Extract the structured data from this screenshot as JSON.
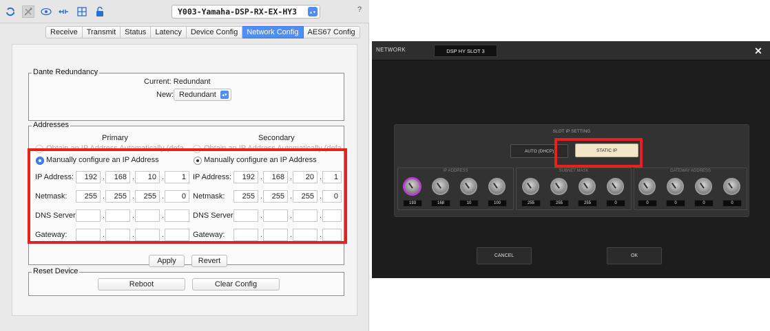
{
  "dante": {
    "device_name": "Y003-Yamaha-DSP-RX-EX-HY3",
    "help_label": "?",
    "tabs": [
      {
        "label": "Receive"
      },
      {
        "label": "Transmit"
      },
      {
        "label": "Status"
      },
      {
        "label": "Latency"
      },
      {
        "label": "Device Config"
      },
      {
        "label": "Network Config",
        "active": true
      },
      {
        "label": "AES67 Config"
      }
    ],
    "redundancy": {
      "title": "Dante Redundancy",
      "current": "Current: Redundant",
      "new_label": "New:",
      "new_value": "Redundant"
    },
    "addresses": {
      "title": "Addresses",
      "primary": {
        "heading": "Primary",
        "auto_option": "Obtain an IP Address Automatically (default)",
        "manual_option": "Manually configure an IP Address",
        "ip_label": "IP Address:",
        "ip": [
          "192",
          "168",
          "10",
          "1"
        ],
        "netmask_label": "Netmask:",
        "netmask": [
          "255",
          "255",
          "255",
          "0"
        ],
        "dns_label": "DNS Server:",
        "gateway_label": "Gateway:"
      },
      "secondary": {
        "heading": "Secondary",
        "auto_option": "Obtain an IP Address Automatically (default)",
        "manual_option": "Manually configure an IP Address",
        "ip_label": "IP Address:",
        "ip": [
          "192",
          "168",
          "20",
          "1"
        ],
        "netmask_label": "Netmask:",
        "netmask": [
          "255",
          "255",
          "255",
          "0"
        ],
        "dns_label": "DNS Server:",
        "gateway_label": "Gateway:"
      }
    },
    "apply_label": "Apply",
    "revert_label": "Revert",
    "reset": {
      "title": "Reset Device",
      "reboot_label": "Reboot",
      "clear_label": "Clear Config"
    },
    "highlight_color": "#e32222",
    "accent_color": "#4e8ef7"
  },
  "yamaha": {
    "title": "NETWORK",
    "slot_tab": "DSP HY SLOT 3",
    "close_label": "✕",
    "slot_setting_title": "SLOT IP SETTING",
    "auto_dhcp_label": "AUTO (DHCP)",
    "static_ip_label": "STATIC IP",
    "ip_address": {
      "title": "IP ADDRESS",
      "values": [
        "193",
        "168",
        "10",
        "100"
      ]
    },
    "subnet_mask": {
      "title": "SUBNET MASK",
      "values": [
        "255",
        "255",
        "255",
        "0"
      ]
    },
    "gateway_address": {
      "title": "GATEWAY ADDRESS",
      "values": [
        "0",
        "0",
        "0",
        "0"
      ]
    },
    "cancel_label": "CANCEL",
    "ok_label": "OK",
    "knob_active_color": "#c03fd8"
  }
}
